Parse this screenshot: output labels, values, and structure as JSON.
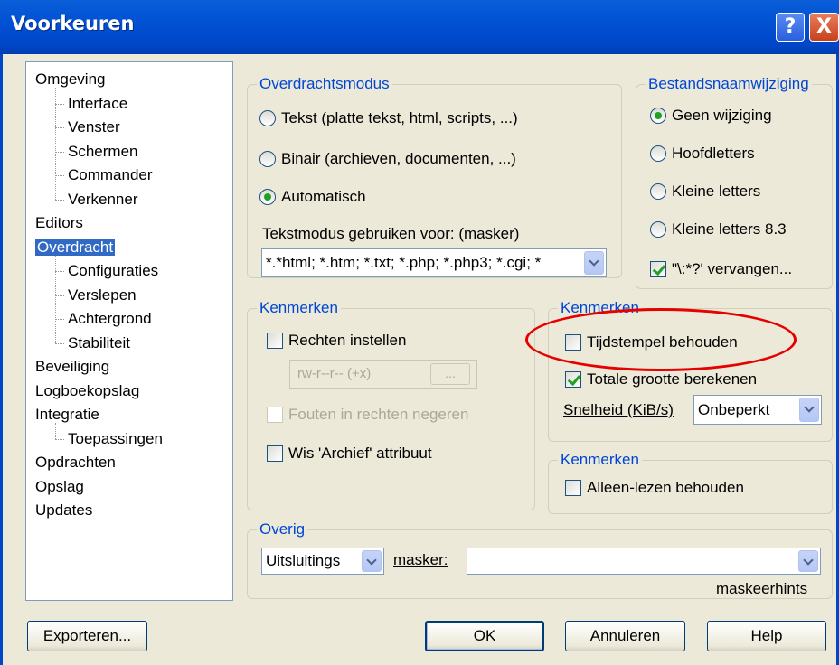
{
  "window": {
    "title": "Voorkeuren",
    "help_glyph": "?",
    "close_glyph": "X"
  },
  "tree": {
    "items": [
      {
        "label": "Omgeving",
        "level": 0
      },
      {
        "label": "Interface",
        "level": 1
      },
      {
        "label": "Venster",
        "level": 1
      },
      {
        "label": "Schermen",
        "level": 1
      },
      {
        "label": "Commander",
        "level": 1
      },
      {
        "label": "Verkenner",
        "level": 1
      },
      {
        "label": "Editors",
        "level": 0
      },
      {
        "label": "Overdracht",
        "level": 0,
        "selected": true
      },
      {
        "label": "Configuraties",
        "level": 1
      },
      {
        "label": "Verslepen",
        "level": 1
      },
      {
        "label": "Achtergrond",
        "level": 1
      },
      {
        "label": "Stabiliteit",
        "level": 1
      },
      {
        "label": "Beveiliging",
        "level": 0
      },
      {
        "label": "Logboekopslag",
        "level": 0
      },
      {
        "label": "Integratie",
        "level": 0
      },
      {
        "label": "Toepassingen",
        "level": 1
      },
      {
        "label": "Opdrachten",
        "level": 0
      },
      {
        "label": "Opslag",
        "level": 0
      },
      {
        "label": "Updates",
        "level": 0
      }
    ]
  },
  "transfer_mode": {
    "title": "Overdrachtsmodus",
    "options": [
      {
        "label": "Tekst (platte tekst, html, scripts, ...)",
        "checked": false
      },
      {
        "label": "Binair (archieven, documenten, ...)",
        "checked": false
      },
      {
        "label": "Automatisch",
        "checked": true
      }
    ],
    "mask_label": "Tekstmodus gebruiken voor: (masker)",
    "mask_value": "*.*html; *.htm; *.txt; *.php; *.php3; *.cgi; *"
  },
  "filename_change": {
    "title": "Bestandsnaamwijziging",
    "options": [
      {
        "label": "Geen wijziging",
        "checked": true
      },
      {
        "label": "Hoofdletters",
        "checked": false
      },
      {
        "label": "Kleine letters",
        "checked": false
      },
      {
        "label": "Kleine letters 8.3",
        "checked": false
      }
    ],
    "replace_label": "\"\\:*?' vervangen...",
    "replace_checked": true
  },
  "properties_left": {
    "title": "Kenmerken",
    "set_rights_label": "Rechten instellen",
    "rights_value": "rw-r--r-- (+x)",
    "rights_btn": "...",
    "ignore_errors_label": "Fouten in rechten negeren",
    "clear_archive_label": "Wis 'Archief' attribuut"
  },
  "properties_right": {
    "title": "Kenmerken",
    "keep_timestamp_label": "Tijdstempel behouden",
    "keep_timestamp_checked": false,
    "calc_size_label": "Totale grootte berekenen",
    "calc_size_checked": true,
    "speed_label": "Snelheid (KiB/s)",
    "speed_value": "Onbeperkt"
  },
  "properties_ro": {
    "title": "Kenmerken",
    "keep_readonly_label": "Alleen-lezen behouden"
  },
  "other": {
    "title": "Overig",
    "exclude_value": "Uitsluitings",
    "mask_label": "masker:",
    "mask_value": "",
    "hints_link": "maskeerhints"
  },
  "buttons": {
    "export": "Exporteren...",
    "ok": "OK",
    "cancel": "Annuleren",
    "help": "Help"
  },
  "colors": {
    "accent": "#0046d5",
    "highlight_circle": "#e60000",
    "selection": "#316ac5"
  }
}
